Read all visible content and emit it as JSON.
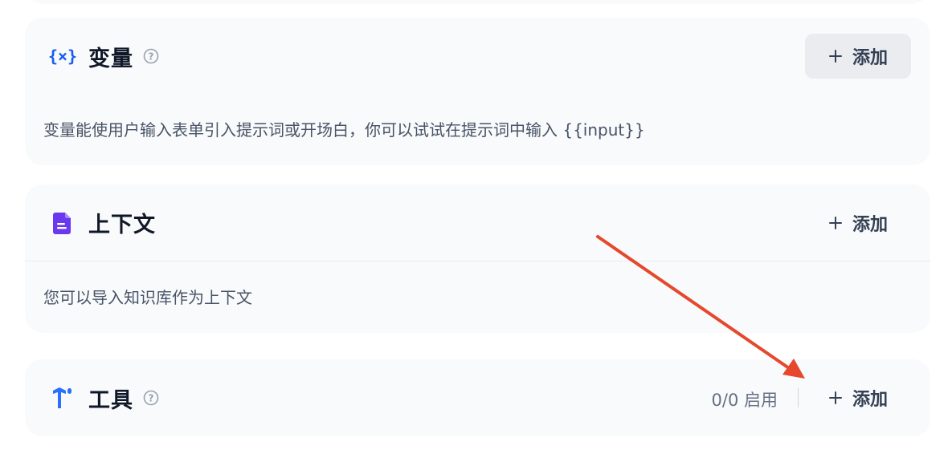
{
  "variables": {
    "title": "变量",
    "add_label": "添加",
    "description": "变量能使用户输入表单引入提示词或开场白，你可以试试在提示词中输入 {{input}}",
    "icon": "variable-braces-icon",
    "accent": "#155eef"
  },
  "context": {
    "title": "上下文",
    "add_label": "添加",
    "description": "您可以导入知识库作为上下文",
    "icon": "document-icon",
    "accent": "#6938ef"
  },
  "tools": {
    "title": "工具",
    "add_label": "添加",
    "enabled_count": "0/0 启用",
    "icon": "tool-icon",
    "accent": "#2970ff"
  },
  "annotation": {
    "arrow_color": "#e5482d"
  }
}
